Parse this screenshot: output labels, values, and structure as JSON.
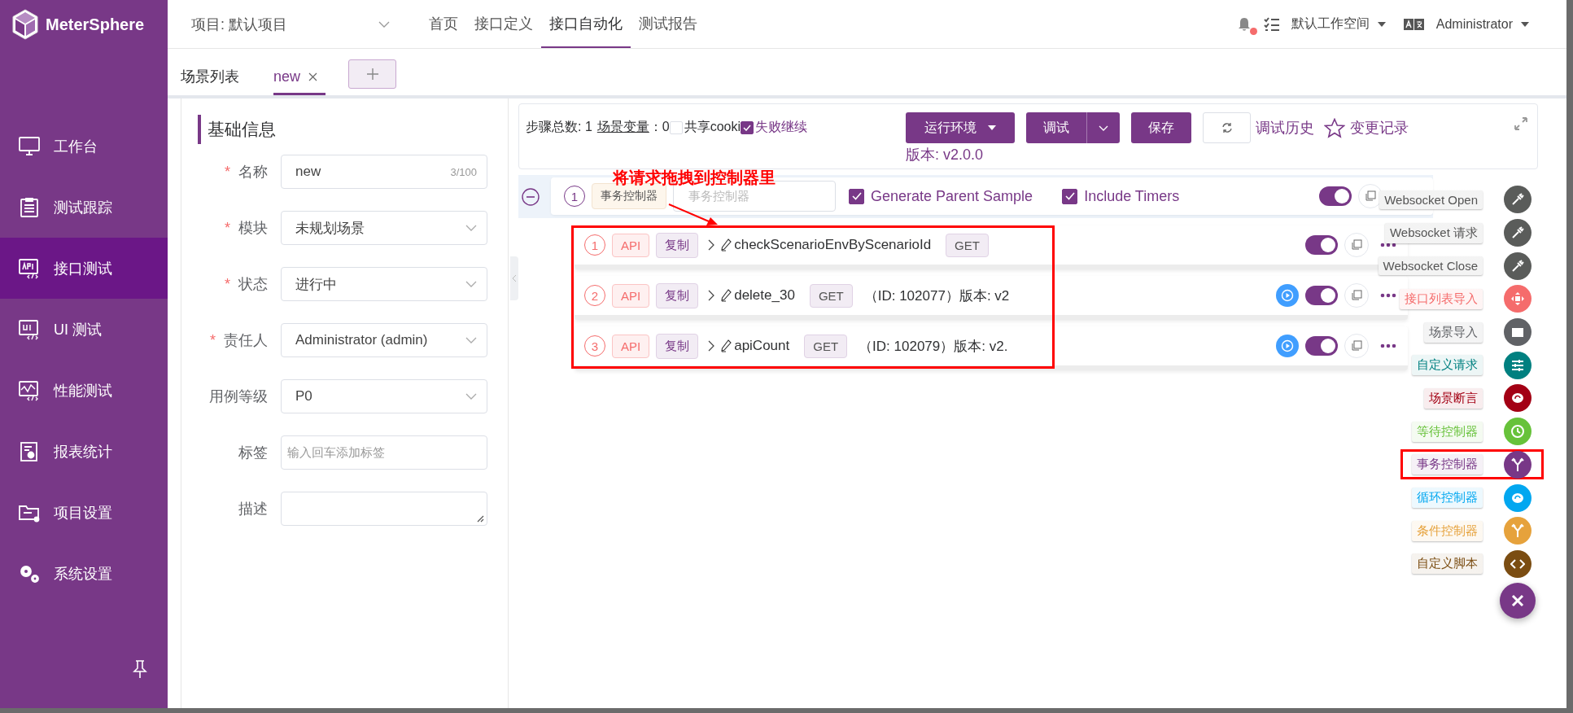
{
  "app": {
    "name": "MeterSphere"
  },
  "header": {
    "project": "项目: 默认项目",
    "nav": [
      {
        "label": "首页",
        "selected": false
      },
      {
        "label": "接口定义",
        "selected": false
      },
      {
        "label": "接口自动化",
        "selected": true
      },
      {
        "label": "测试报告",
        "selected": false
      }
    ],
    "has_notifications": true,
    "workspace": "默认工作空间",
    "user": "Administrator"
  },
  "sidebar": {
    "items": [
      {
        "label": "工作台",
        "kind": "monitor",
        "selected": false
      },
      {
        "label": "测试跟踪",
        "kind": "clipboard",
        "selected": false
      },
      {
        "label": "接口测试",
        "kind": "api",
        "selected": true
      },
      {
        "label": "UI 测试",
        "kind": "ui",
        "selected": false
      },
      {
        "label": "性能测试",
        "kind": "perf",
        "selected": false
      },
      {
        "label": "报表统计",
        "kind": "report",
        "selected": false
      },
      {
        "label": "项目设置",
        "kind": "folder",
        "selected": false
      },
      {
        "label": "系统设置",
        "kind": "gears",
        "selected": false
      }
    ]
  },
  "tabs": [
    {
      "label": "场景列表",
      "selected": false,
      "closable": false
    },
    {
      "label": "new",
      "selected": true,
      "closable": true
    }
  ],
  "form": {
    "title": "基础信息",
    "fields": [
      {
        "label": "名称",
        "required_mark": "*",
        "kind": "text",
        "value": "new",
        "counter": "3/100"
      },
      {
        "label": "模块",
        "required_mark": "*",
        "kind": "select",
        "value": "未规划场景"
      },
      {
        "label": "状态",
        "required_mark": "*",
        "kind": "select",
        "value": "进行中"
      },
      {
        "label": "责任人",
        "required_mark": "*",
        "kind": "select",
        "value": "Administrator (admin)"
      },
      {
        "label": "用例等级",
        "kind": "select",
        "value": "P0"
      },
      {
        "label": "标签",
        "kind": "text",
        "placeholder": "输入回车添加标签"
      },
      {
        "label": "描述",
        "kind": "textarea"
      }
    ]
  },
  "toolbar": {
    "step_count_label": "步骤总数:",
    "step_count": "1",
    "variables_link": "场景变量",
    "variables_count": "：0",
    "share_cookie": {
      "label": "共享cooki",
      "checked": false
    },
    "fail_continue": {
      "label": "失败继续",
      "checked": true
    },
    "env_button": "运行环境",
    "debug_button": "调试",
    "save_button": "保存",
    "history_link": "调试历史",
    "changes_link": "变更记录",
    "version": "版本: v2.0.0"
  },
  "controller": {
    "expanded": true,
    "index": "1",
    "tag": "事务控制器",
    "name_placeholder": "事务控制器",
    "enabled": true,
    "options": [
      {
        "label": "Generate Parent Sample",
        "checked": true
      },
      {
        "label": "Include Timers",
        "checked": true
      }
    ]
  },
  "steps": [
    {
      "index": "1",
      "type": "API",
      "copy_tag": "复制",
      "name": "checkScenarioEnvByScenarioId",
      "method": "GET",
      "runnable": false,
      "enabled": true
    },
    {
      "index": "2",
      "type": "API",
      "copy_tag": "复制",
      "name": "delete_30",
      "method": "GET",
      "detail": "（ID: 102077）版本: v2",
      "runnable": true,
      "enabled": true
    },
    {
      "index": "3",
      "type": "API",
      "copy_tag": "复制",
      "name": "apiCount",
      "method": "GET",
      "detail": "（ID: 102079）版本: v2.",
      "runnable": true,
      "enabled": true
    }
  ],
  "annotation": {
    "text": "将请求拖拽到控制器里"
  },
  "menu": {
    "items": [
      {
        "label": "Websocket Open",
        "kind": "websocket",
        "color": "#5a5c5a"
      },
      {
        "label": "Websocket 请求",
        "kind": "websocket",
        "color": "#5a5c5a"
      },
      {
        "label": "Websocket Close",
        "kind": "websocket",
        "color": "#5a5c5a"
      },
      {
        "label": "接口列表导入",
        "kind": "import",
        "color": "#f56c6c"
      },
      {
        "label": "场景导入",
        "kind": "scenario",
        "color": "#606266"
      },
      {
        "label": "自定义请求",
        "kind": "custom",
        "color": "#008080"
      },
      {
        "label": "场景断言",
        "kind": "assertion",
        "color": "#a30014"
      },
      {
        "label": "等待控制器",
        "kind": "wait",
        "color": "#67c23a"
      },
      {
        "label": "事务控制器",
        "kind": "transaction",
        "color": "#783887"
      },
      {
        "label": "循环控制器",
        "kind": "loop",
        "color": "#02a7f0"
      },
      {
        "label": "条件控制器",
        "kind": "condition",
        "color": "#e6a23c"
      },
      {
        "label": "自定义脚本",
        "kind": "script",
        "color": "#7b4d12"
      }
    ]
  }
}
